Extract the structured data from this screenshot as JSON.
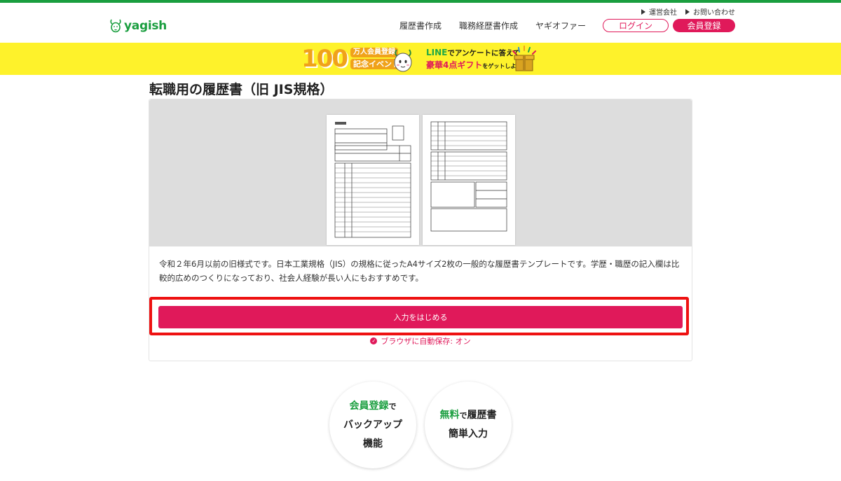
{
  "header": {
    "logo_text": "yagish",
    "util_links": [
      "運営会社",
      "お問い合わせ"
    ],
    "nav": [
      "履歴書作成",
      "職務経歴書作成",
      "ヤギオファー"
    ],
    "login_label": "ログイン",
    "register_label": "会員登録"
  },
  "banner": {
    "count": "100",
    "member_label": "万人会員登録",
    "event_label": "記念イベント",
    "line_brand": "LINE",
    "line_text": "でアンケートに答えて",
    "gift_prefix": "豪華4点ギフト",
    "gift_suffix": "をゲットしよう!"
  },
  "main": {
    "title": "転職用の履歴書（旧 JIS規格）",
    "description": "令和２年6月以前の旧様式です。日本工業規格（JIS）の規格に従ったA4サイズ2枚の一般的な履歴書テンプレートです。学歴・職歴の記入欄は比較的広めのつくりになっており、社会人経験が長い人にもおすすめです。",
    "start_button": "入力をはじめる",
    "autosave": "ブラウザに自動保存: オン"
  },
  "features": [
    {
      "highlight": "会員登録",
      "suffix": "で",
      "line2": "バックアップ",
      "line3": "機能"
    },
    {
      "highlight": "無料",
      "suffix": "で",
      "tail": "履歴書",
      "line2": "簡単入力"
    }
  ],
  "colors": {
    "brand_green": "#1a9e3f",
    "accent_pink": "#e0195a",
    "banner_yellow": "#fef22b",
    "highlight_red": "#ee1111"
  }
}
